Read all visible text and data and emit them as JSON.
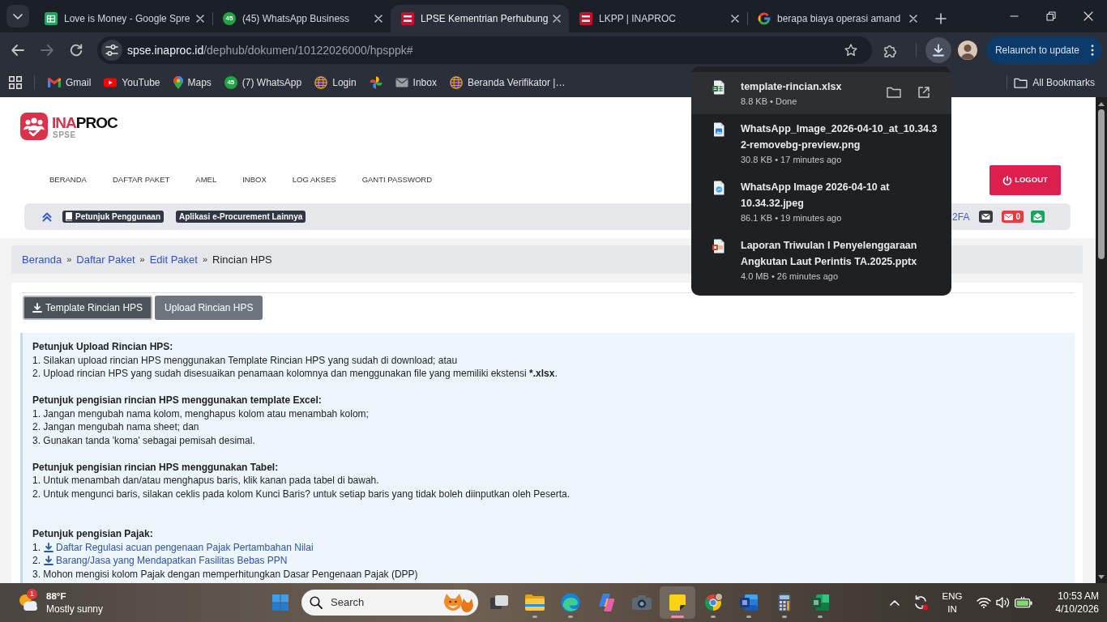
{
  "browser": {
    "tabs": [
      {
        "title": "Love is Money - Google Spre",
        "kind": "sheets",
        "selected": false
      },
      {
        "title": "(45) WhatsApp Business",
        "kind": "chat",
        "count": "45",
        "selected": false
      },
      {
        "title": "LPSE Kementrian Perhubung",
        "kind": "inaproc",
        "selected": true
      },
      {
        "title": "LKPP | INAPROC",
        "kind": "inaproc",
        "selected": false
      },
      {
        "title": "berapa biaya operasi amand",
        "kind": "google",
        "selected": false
      }
    ],
    "forward_disabled": true,
    "address": {
      "host": "spse.inaproc.id",
      "path": "/dephub/dokumen/10122026000/hpsppk#"
    },
    "relaunch": "Relaunch to update",
    "bookmarks": [
      {
        "label": "Gmail",
        "kind": "gmail"
      },
      {
        "label": "YouTube",
        "kind": "youtube"
      },
      {
        "label": "Maps",
        "kind": "maps"
      },
      {
        "label": "(7) WhatsApp",
        "kind": "chat",
        "count": "45"
      },
      {
        "label": "Login",
        "kind": "globe"
      },
      {
        "kind": "pinwheel"
      },
      {
        "label": "Inbox",
        "kind": "mail"
      },
      {
        "label": "Beranda Verifikator |…",
        "kind": "globe"
      }
    ],
    "all_bookmarks": "All Bookmarks"
  },
  "page": {
    "logo": {
      "accent": "INA",
      "name": "PROC",
      "product": "SPSE"
    },
    "menu": [
      "BERANDA",
      "DAFTAR PAKET",
      "AMEL",
      "INBOX",
      "LOG AKSES",
      "GANTI PASSWORD"
    ],
    "logout": "LOGOUT",
    "quick_links": [
      {
        "label": "Petunjuk Penggunaan",
        "kind": "book"
      },
      {
        "label": "Aplikasi e-Procurement Lainnya",
        "kind": "plain"
      }
    ],
    "account_link": "2FA",
    "unread_count": "0",
    "breadcrumb": {
      "separator": "»",
      "items": [
        {
          "label": "Beranda",
          "link": true
        },
        {
          "label": "Daftar Paket",
          "link": true
        },
        {
          "label": "Edit Paket",
          "link": true
        },
        {
          "label": "Rincian HPS",
          "link": false
        }
      ]
    },
    "actions": [
      {
        "label": "Template Rincian HPS",
        "kind": "download",
        "selected": true
      },
      {
        "label": "Upload Rincian HPS",
        "kind": "plain",
        "selected": false
      }
    ],
    "instructions": [
      {
        "kind": "heading",
        "text": "Petunjuk Upload Rincian HPS:"
      },
      {
        "kind": "text",
        "text": "1. Silakan upload rincian HPS menggunakan Template Rincian HPS yang sudah di download; atau"
      },
      {
        "kind": "text",
        "parts": [
          {
            "text": "2. Upload rincian HPS yang sudah disesuaikan penamaan kolomnya dan menggunakan file yang memiliki ekstensi ",
            "bold": false
          },
          {
            "text": "*.xlsx",
            "bold": true
          },
          {
            "text": ".",
            "bold": false
          }
        ]
      },
      {
        "kind": "blank"
      },
      {
        "kind": "heading",
        "text": "Petunjuk pengisian rincian HPS menggunakan template Excel:"
      },
      {
        "kind": "text",
        "text": "1. Jangan mengubah nama kolom, menghapus kolom atau menambah kolom;"
      },
      {
        "kind": "text",
        "text": "2. Jangan mengubah nama sheet; dan"
      },
      {
        "kind": "text",
        "text": "3. Gunakan tanda 'koma' sebagai pemisah desimal."
      },
      {
        "kind": "blank"
      },
      {
        "kind": "heading",
        "text": "Petunjuk pengisian rincian HPS menggunakan Tabel:"
      },
      {
        "kind": "text",
        "text": "1. Untuk menambah dan/atau menghapus baris, klik kanan pada tabel di bawah."
      },
      {
        "kind": "text",
        "text": "2. Untuk mengunci baris, silakan ceklis pada kolom Kunci Baris? untuk setiap baris yang tidak boleh diinputkan oleh Peserta."
      },
      {
        "kind": "blank"
      },
      {
        "kind": "blank"
      },
      {
        "kind": "heading",
        "text": "Petunjuk pengisian Pajak:"
      },
      {
        "kind": "link",
        "number": "1.",
        "text": "Daftar Regulasi acuan pengenaan Pajak Pertambahan Nilai"
      },
      {
        "kind": "link",
        "number": "2.",
        "text": "Barang/Jasa yang Mendapatkan Fasilitas Bebas PPN"
      },
      {
        "kind": "text",
        "text": "3. Mohon mengisi kolom Pajak dengan memperhitungkan Dasar Pengenaan Pajak (DPP)"
      }
    ]
  },
  "downloads": {
    "open": true,
    "items": [
      {
        "name": "template-rincian.xlsx",
        "meta": "8.8 KB • Done",
        "kind": "sheet",
        "selected": true
      },
      {
        "name": "WhatsApp_Image_2026-04-10_at_10.34.32-removebg-preview.png",
        "meta": "30.8 KB • 17 minutes ago",
        "kind": "image",
        "selected": false
      },
      {
        "name": "WhatsApp Image 2026-04-10 at 10.34.32.jpeg",
        "meta": "86.1 KB • 19 minutes ago",
        "kind": "photo",
        "selected": false
      },
      {
        "name": "Laporan Triwulan I Penyelenggaraan Angkutan Laut Perintis TA.2025.pptx",
        "meta": "4.0 MB • 26 minutes ago",
        "kind": "slides",
        "selected": false
      }
    ]
  },
  "taskbar": {
    "weather": {
      "temperature": "88°F",
      "condition": "Mostly sunny",
      "alerts": "1"
    },
    "search": {
      "label": "Search"
    },
    "apps": [
      {
        "kind": "taskview",
        "running": false,
        "selected": false
      },
      {
        "kind": "explorer",
        "running": true,
        "selected": false
      },
      {
        "kind": "edge",
        "running": true,
        "selected": false
      },
      {
        "kind": "copilot",
        "running": false,
        "selected": false
      },
      {
        "kind": "camera",
        "running": false,
        "selected": false
      },
      {
        "kind": "sticky",
        "running": true,
        "selected": true
      },
      {
        "kind": "chrome",
        "running": true,
        "selected": false
      },
      {
        "kind": "word",
        "running": true,
        "selected": false
      },
      {
        "kind": "calculator",
        "running": true,
        "selected": false
      },
      {
        "kind": "excel",
        "running": true,
        "selected": false
      }
    ],
    "language": {
      "input": "ENG",
      "region": "IN"
    },
    "time": "10:53 AM",
    "date": "4/10/2026"
  }
}
